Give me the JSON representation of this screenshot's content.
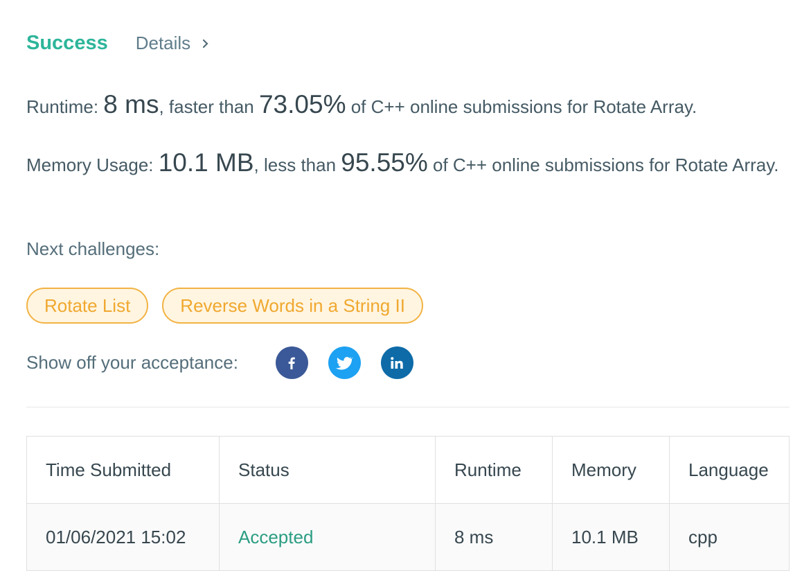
{
  "header": {
    "status": "Success",
    "details_label": "Details"
  },
  "runtime": {
    "label": "Runtime: ",
    "value": "8 ms",
    "comparison": ", faster than ",
    "percent": "73.05%",
    "suffix": " of C++ online submissions for Rotate Array."
  },
  "memory": {
    "label": "Memory Usage: ",
    "value": "10.1 MB",
    "comparison": ", less than ",
    "percent": "95.55%",
    "suffix": " of C++ online submissions for Rotate Array."
  },
  "next_challenges": {
    "label": "Next challenges:",
    "items": [
      "Rotate List",
      "Reverse Words in a String II"
    ]
  },
  "share": {
    "label": "Show off your acceptance:",
    "icons": [
      "facebook-icon",
      "twitter-icon",
      "linkedin-icon"
    ],
    "colors": {
      "facebook": "#3b5998",
      "twitter": "#1da1f2",
      "linkedin": "#0e6ba8"
    }
  },
  "table": {
    "headers": [
      "Time Submitted",
      "Status",
      "Runtime",
      "Memory",
      "Language"
    ],
    "rows": [
      {
        "time": "01/06/2021 15:02",
        "status": "Accepted",
        "runtime": "8 ms",
        "memory": "10.1 MB",
        "language": "cpp"
      }
    ]
  },
  "colors": {
    "success": "#2db59a",
    "chip_border": "#f2b344",
    "chip_text": "#f0a82f",
    "accepted": "#2a9d82"
  }
}
